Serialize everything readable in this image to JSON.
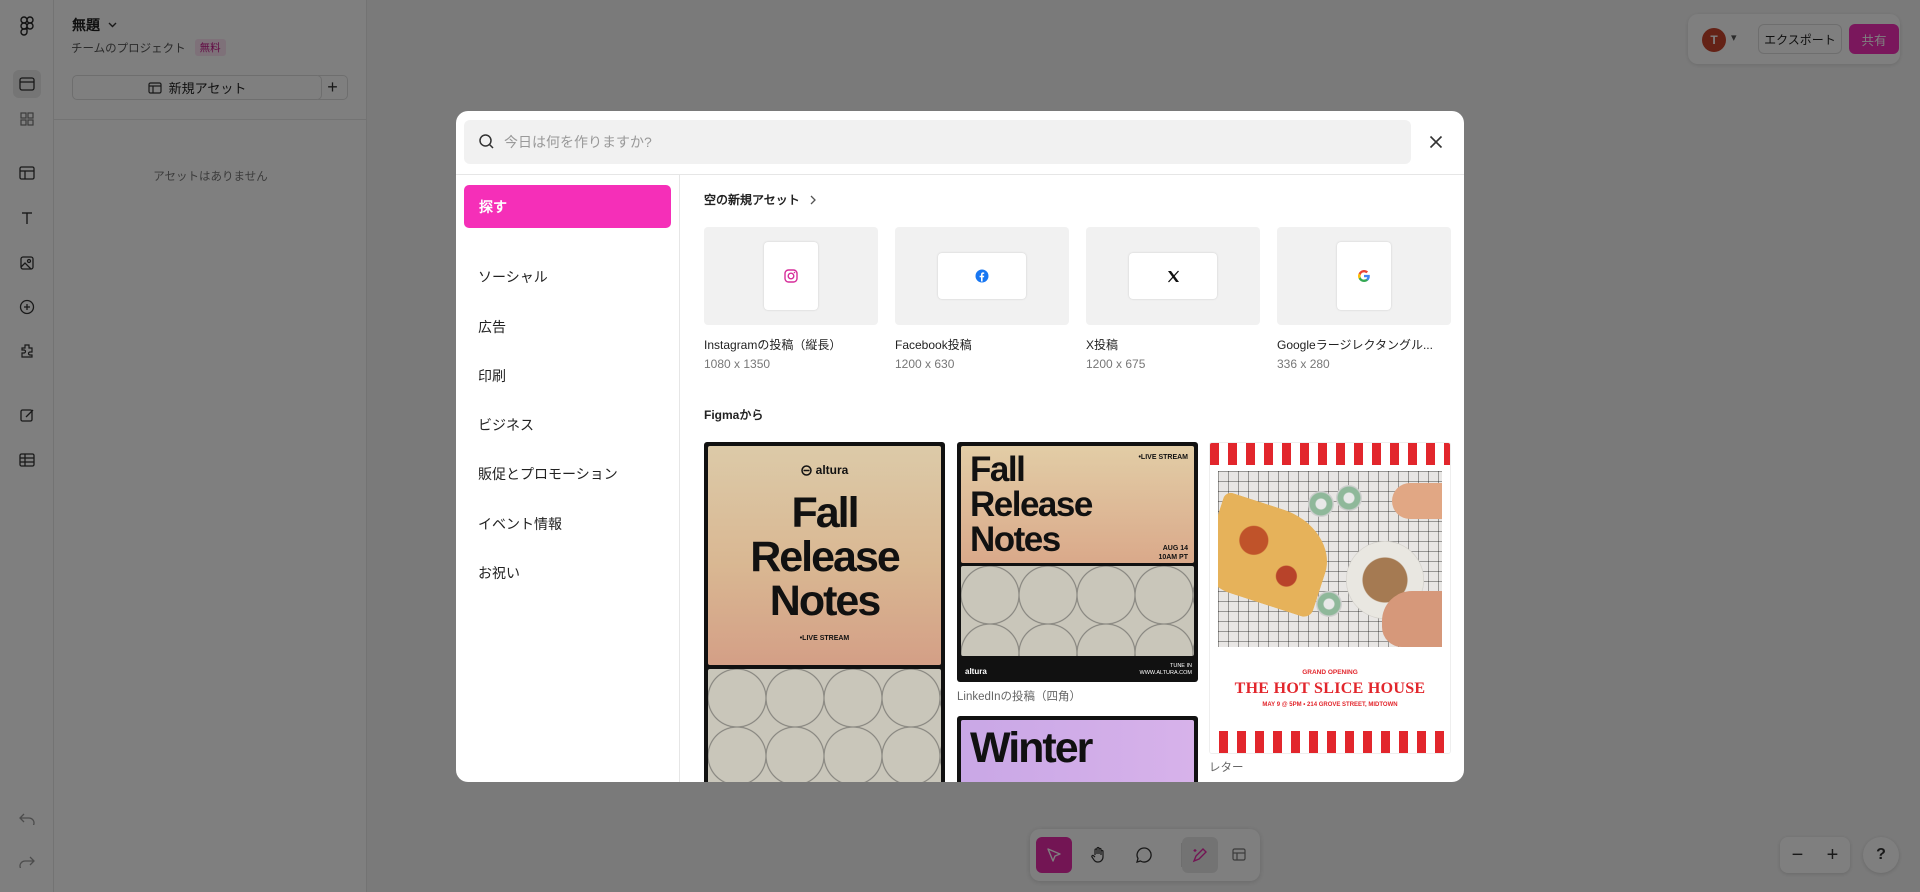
{
  "app": {
    "file_title": "無題",
    "project_label": "チームのプロジェクト",
    "plan_badge": "無料",
    "new_asset_label": "新規アセット",
    "add_label": "+",
    "no_assets_text": "アセットはありません",
    "avatar_initial": "T",
    "export_label": "エクスポート",
    "share_label": "共有",
    "help_label": "?",
    "accent_color": "#f52fb8"
  },
  "modal": {
    "search_placeholder": "今日は何を作りますか?",
    "nav": {
      "active": "探す",
      "items": [
        "ソーシャル",
        "広告",
        "印刷",
        "ビジネス",
        "販促とプロモーション",
        "イベント情報",
        "お祝い"
      ]
    },
    "blank_section_title": "空の新規アセット",
    "blank_assets": [
      {
        "name": "Instagramの投稿（縦長）",
        "size": "1080 x 1350",
        "icon": "instagram-icon"
      },
      {
        "name": "Facebook投稿",
        "size": "1200 x 630",
        "icon": "facebook-icon"
      },
      {
        "name": "X投稿",
        "size": "1200 x 675",
        "icon": "x-icon"
      },
      {
        "name": "Googleラージレクタングル...",
        "size": "336 x 280",
        "icon": "google-icon"
      }
    ],
    "figma_section_title": "Figmaから",
    "templates": {
      "fall_tall": {
        "brand": "altura",
        "headline_1": "Fall",
        "headline_2": "Release",
        "headline_3": "Notes",
        "tag": "•LIVE STREAM"
      },
      "linkedin": {
        "headline_1": "Fall",
        "headline_2": "Release",
        "headline_3": "Notes",
        "tag": "•LIVE STREAM",
        "date_1": "AUG 14",
        "date_2": "10AM PT",
        "brand": "altura",
        "tune_1": "TUNE IN",
        "tune_2": "WWW.ALTURA.COM",
        "caption": "LinkedInの投稿（四角）"
      },
      "winter": {
        "headline": "Winter"
      },
      "pizza": {
        "grand_opening": "GRAND OPENING",
        "title": "THE HOT SLICE HOUSE",
        "address": "MAY 9 @ 5PM  •  214 GROVE STREET, MIDTOWN",
        "caption": "レター"
      }
    }
  }
}
